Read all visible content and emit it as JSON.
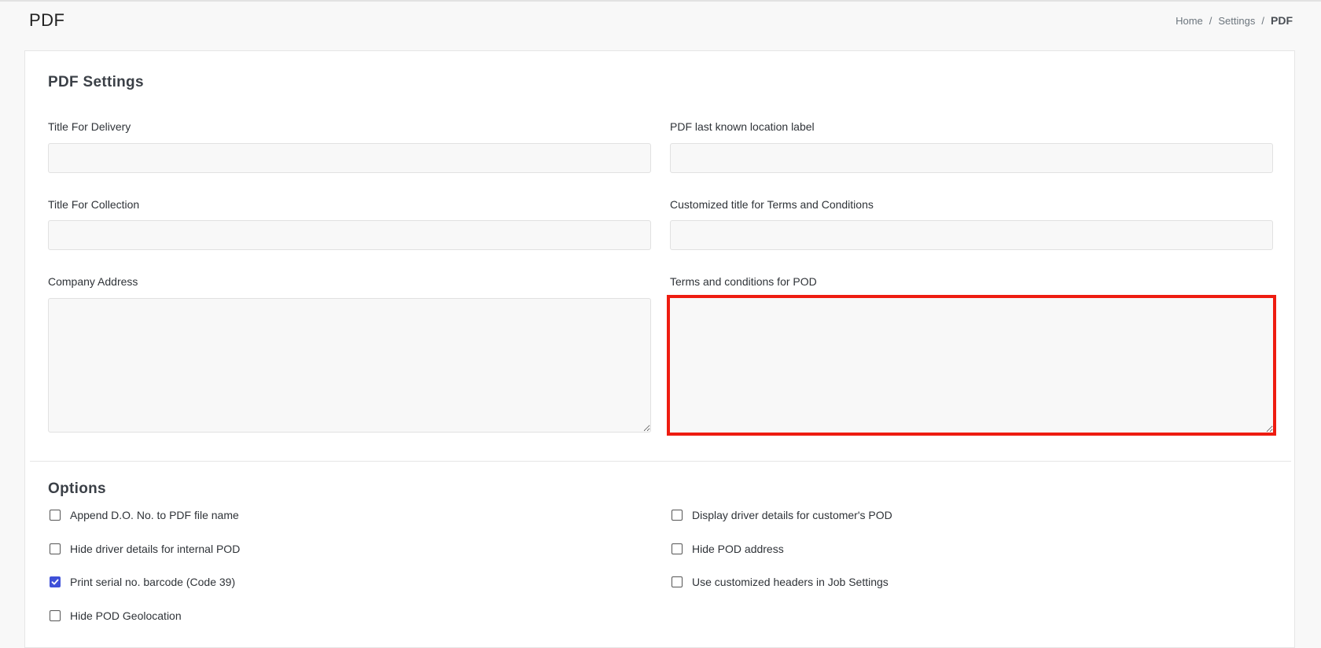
{
  "header": {
    "title": "PDF",
    "breadcrumb": [
      {
        "label": "Home"
      },
      {
        "label": "Settings"
      },
      {
        "label": "PDF"
      }
    ],
    "separator": "/"
  },
  "pdf_settings": {
    "section_title": "PDF Settings",
    "fields": {
      "title_for_delivery": {
        "label": "Title For Delivery",
        "value": "",
        "placeholder": ""
      },
      "pdf_last_known_location_label": {
        "label": "PDF last known location label",
        "value": "",
        "placeholder": ""
      },
      "title_for_collection": {
        "label": "Title For Collection",
        "value": "",
        "placeholder": ""
      },
      "customized_title_terms": {
        "label": "Customized title for Terms and Conditions",
        "value": "",
        "placeholder": ""
      },
      "company_address": {
        "label": "Company Address",
        "value": "",
        "placeholder": ""
      },
      "terms_for_pod": {
        "label": "Terms and conditions for POD",
        "value": "",
        "placeholder": ""
      }
    }
  },
  "options": {
    "section_title": "Options",
    "items": [
      {
        "label": "Append D.O. No. to PDF file name",
        "checked": false
      },
      {
        "label": "Display driver details for customer's POD",
        "checked": false
      },
      {
        "label": "Hide driver details for internal POD",
        "checked": false
      },
      {
        "label": "Hide POD address",
        "checked": false
      },
      {
        "label": "Print serial no. barcode (Code 39)",
        "checked": true
      },
      {
        "label": "Use customized headers in Job Settings",
        "checked": false
      },
      {
        "label": "Hide POD Geolocation",
        "checked": false
      }
    ]
  },
  "colors": {
    "accent": "#3f51d8",
    "highlight": "#ee1c10",
    "input_bg": "#f8f8f8"
  }
}
